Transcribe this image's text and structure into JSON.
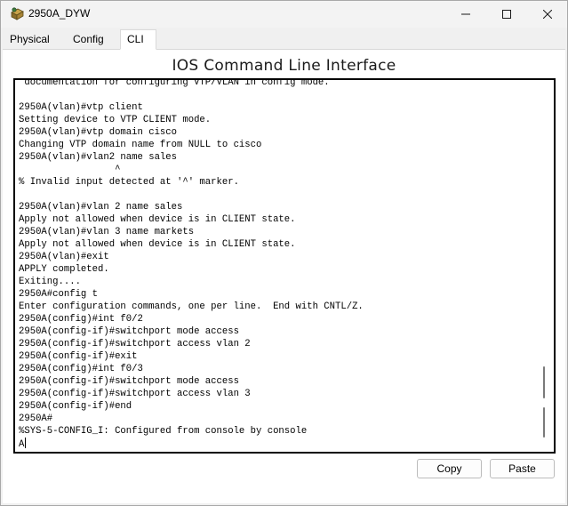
{
  "window": {
    "title": "2950A_DYW",
    "minimize_glyph": "—",
    "maximize_glyph": "☐",
    "close_glyph": "✕"
  },
  "tabs": [
    {
      "label": "Physical",
      "active": false
    },
    {
      "label": "Config",
      "active": false
    },
    {
      "label": "CLI",
      "active": true
    }
  ],
  "panel": {
    "title": "IOS Command Line Interface"
  },
  "terminal": {
    "lines": [
      " documentation for configuring VTP/VLAN in config mode.",
      "",
      "2950A(vlan)#vtp client",
      "Setting device to VTP CLIENT mode.",
      "2950A(vlan)#vtp domain cisco",
      "Changing VTP domain name from NULL to cisco",
      "2950A(vlan)#vlan2 name sales",
      "                 ^",
      "% Invalid input detected at '^' marker.",
      "",
      "2950A(vlan)#vlan 2 name sales",
      "Apply not allowed when device is in CLIENT state.",
      "2950A(vlan)#vlan 3 name markets",
      "Apply not allowed when device is in CLIENT state.",
      "2950A(vlan)#exit",
      "APPLY completed.",
      "Exiting....",
      "2950A#config t",
      "Enter configuration commands, one per line.  End with CNTL/Z.",
      "2950A(config)#int f0/2",
      "2950A(config-if)#switchport mode access",
      "2950A(config-if)#switchport access vlan 2",
      "2950A(config-if)#exit",
      "2950A(config)#int f0/3",
      "2950A(config-if)#switchport mode access",
      "2950A(config-if)#switchport access vlan 3",
      "2950A(config-if)#end",
      "2950A#",
      "%SYS-5-CONFIG_I: Configured from console by console",
      "A"
    ]
  },
  "buttons": {
    "copy": "Copy",
    "paste": "Paste"
  },
  "colors": {
    "window_bg": "#f0f0f0",
    "panel_bg": "#ffffff",
    "terminal_border": "#000000"
  },
  "icons": {
    "app": "packet-tracer-switch-icon"
  }
}
